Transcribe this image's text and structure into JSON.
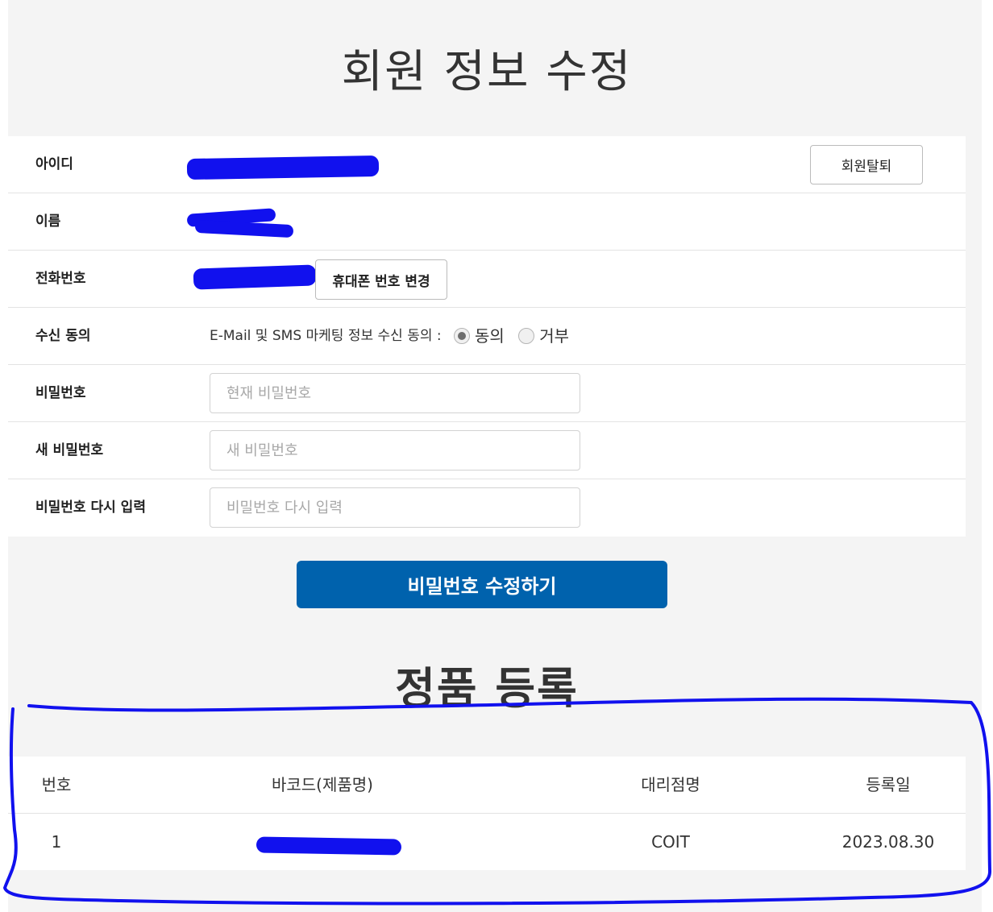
{
  "page": {
    "title": "회원 정보 수정"
  },
  "member_form": {
    "id": {
      "label": "아이디",
      "withdraw_button": "회원탈퇴"
    },
    "name": {
      "label": "이름"
    },
    "phone": {
      "label": "전화번호",
      "change_button": "휴대폰 번호 변경"
    },
    "consent": {
      "label": "수신 동의",
      "text": "E-Mail 및 SMS 마케팅 정보 수신 동의 :",
      "options": [
        {
          "label": "동의",
          "checked": true
        },
        {
          "label": "거부",
          "checked": false
        }
      ]
    },
    "password": {
      "label": "비밀번호",
      "placeholder": "현재 비밀번호"
    },
    "new_password": {
      "label": "새 비밀번호",
      "placeholder": "새 비밀번호"
    },
    "confirm_password": {
      "label": "비밀번호 다시 입력",
      "placeholder": "비밀번호 다시 입력"
    },
    "submit_button": "비밀번호 수정하기"
  },
  "registration": {
    "title": "정품 등록",
    "columns": [
      "번호",
      "바코드(제품명)",
      "대리점명",
      "등록일"
    ],
    "rows": [
      {
        "no": "1",
        "agency": "COIT",
        "date": "2023.08.30"
      }
    ]
  },
  "colors": {
    "primary_button": "#0062ad",
    "annotation_ink": "#1111ee",
    "page_background": "#f4f4f4"
  }
}
